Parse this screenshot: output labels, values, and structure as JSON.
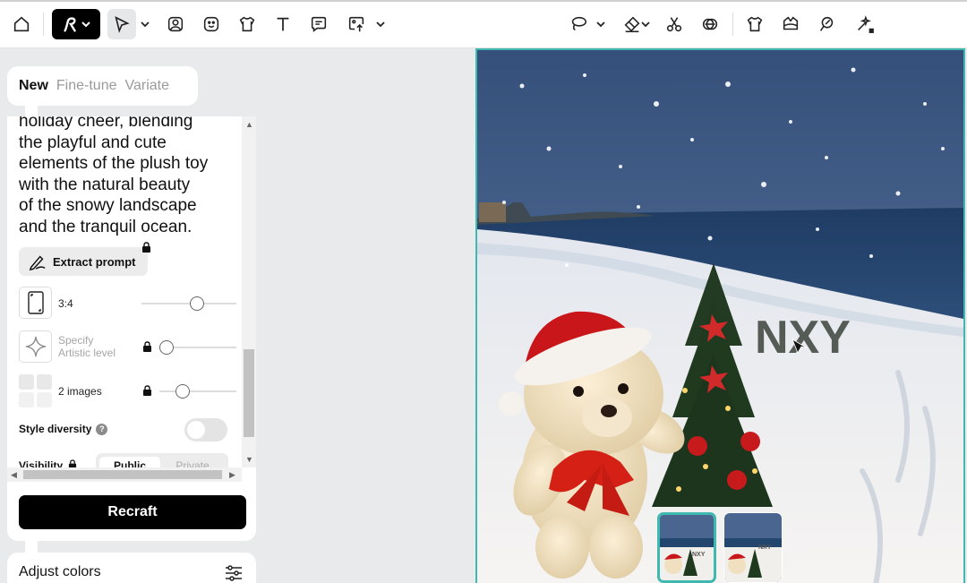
{
  "toolbar": {
    "tools": [
      "home-icon",
      "logo-menu",
      "select-tool",
      "image-icon",
      "sticker-icon",
      "mockup-icon",
      "text-tool",
      "comment-tool",
      "upload-icon",
      "lasso-tool",
      "eraser-tool",
      "scissors-tool",
      "layers-icon",
      "tshirt-icon",
      "background-icon",
      "brush-icon",
      "magic-icon"
    ]
  },
  "left_panel": {
    "tabs": [
      "New",
      "Fine-tune",
      "Variate"
    ],
    "prompt_lines": [
      "holiday cheer, blending",
      "the playful and cute",
      "elements of the plush toy",
      "with the natural beauty",
      "of the snowy landscape",
      "and the tranquil ocean."
    ],
    "extract_label": "Extract prompt",
    "aspect_label": "3:4",
    "aspect_value": 0.6,
    "artistic_label_1": "Specify",
    "artistic_label_2": "Artistic level",
    "images_label": "2 images",
    "images_value": 0.25,
    "style_diversity_label": "Style diversity",
    "help_mark": "?",
    "visibility_label": "Visibility",
    "visibility_options": [
      "Public",
      "Private"
    ],
    "recraft_label": "Recraft",
    "adjust_colors_label": "Adjust colors"
  },
  "canvas": {
    "sign_text": "NXY",
    "thumb_text": "NXY",
    "accent": "#3fb8b0"
  }
}
